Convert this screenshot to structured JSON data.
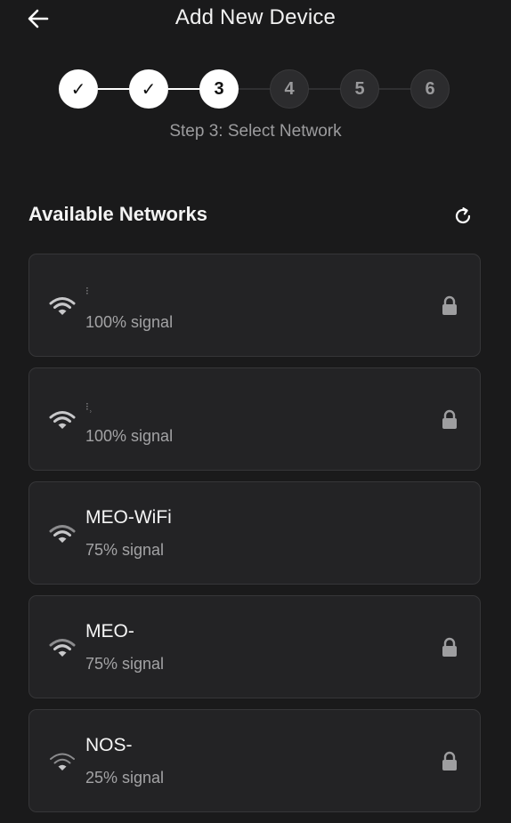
{
  "header": {
    "title": "Add New Device",
    "back_icon": "arrow-left-icon"
  },
  "stepper": {
    "steps": [
      {
        "label": "✓",
        "state": "done"
      },
      {
        "label": "✓",
        "state": "done"
      },
      {
        "label": "3",
        "state": "active"
      },
      {
        "label": "4",
        "state": "pending"
      },
      {
        "label": "5",
        "state": "pending"
      },
      {
        "label": "6",
        "state": "pending"
      }
    ],
    "caption": "Step 3: Select Network"
  },
  "networks_section": {
    "title": "Available Networks",
    "refresh_icon": "refresh-icon"
  },
  "networks": [
    {
      "name": "⁝",
      "signal": "100% signal",
      "secured": true,
      "strength": 1.0
    },
    {
      "name": "⁝⸒",
      "signal": "100% signal",
      "secured": true,
      "strength": 1.0
    },
    {
      "name": "MEO-WiFi",
      "signal": "75% signal",
      "secured": false,
      "strength": 0.75
    },
    {
      "name": "MEO-",
      "signal": "75% signal",
      "secured": true,
      "strength": 0.75
    },
    {
      "name": "NOS-",
      "signal": "25% signal",
      "secured": true,
      "strength": 0.25
    }
  ],
  "colors": {
    "background": "#1a1a1b",
    "card": "#232325",
    "card_border": "#363638",
    "step_done": "#ffffff",
    "step_pending": "#2c2c2e",
    "muted_text": "#9c9c9e"
  }
}
